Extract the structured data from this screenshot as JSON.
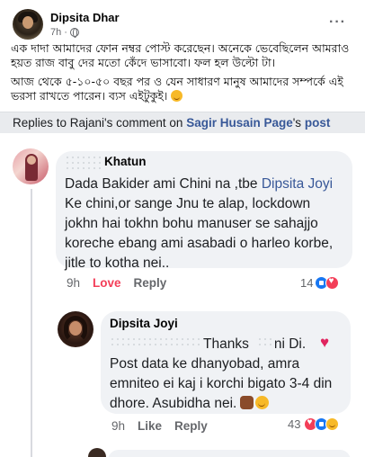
{
  "post": {
    "author": "Dipsita Dhar",
    "time": "7h",
    "dot": "·",
    "more": "···",
    "paragraph1": "এক দাদা আমাদের ফোন নম্বর পোস্ট করেছেন। অনেকে ভেবেছিলেন আমরাও হয়ত রাজ বাবু দের মতো কেঁদে ভাসাবো। ফল হল উল্টো টা।",
    "paragraph2": "আজ থেকে ৫-১০-৫০ বছর পর ও যেন সাধারণ মানুষ আমাদের সম্পর্কে এই ভরসা রাখতে পারেন। ব্যস এইটুকুই।"
  },
  "replies_header": {
    "prefix": "Replies to Rajani's comment on",
    "page_link": "Sagir Husain Page",
    "possessive": "'s",
    "post_link": "post"
  },
  "comment1": {
    "name": "Khatun",
    "text_before": "Dada Bakider ami Chini na ,tbe",
    "mention": "Dipsita Joyi",
    "text_after": "Ke chini,or sange Jnu te alap, lockdown jokhn hai tokhn bohu manuser se sahajjo koreche ebang ami asabadi o harleo korbe, jitle to kotha nei..",
    "time": "9h",
    "love_label": "Love",
    "reply_label": "Reply",
    "reaction_count": "14"
  },
  "comment2": {
    "name": "Dipsita Joyi",
    "line1": "Thanks",
    "line1_tail": "ni Di.",
    "text": "Post data ke dhanyobad, amra emniteo ei kaj i korchi bigato 3-4 din dhore. Asubidha nei.",
    "time": "9h",
    "like_label": "Like",
    "reply_label": "Reply",
    "reaction_count": "43"
  },
  "colors": {
    "link": "#385898",
    "love": "#f33e58",
    "like": "#1877f2",
    "bubble": "#f0f2f5"
  }
}
